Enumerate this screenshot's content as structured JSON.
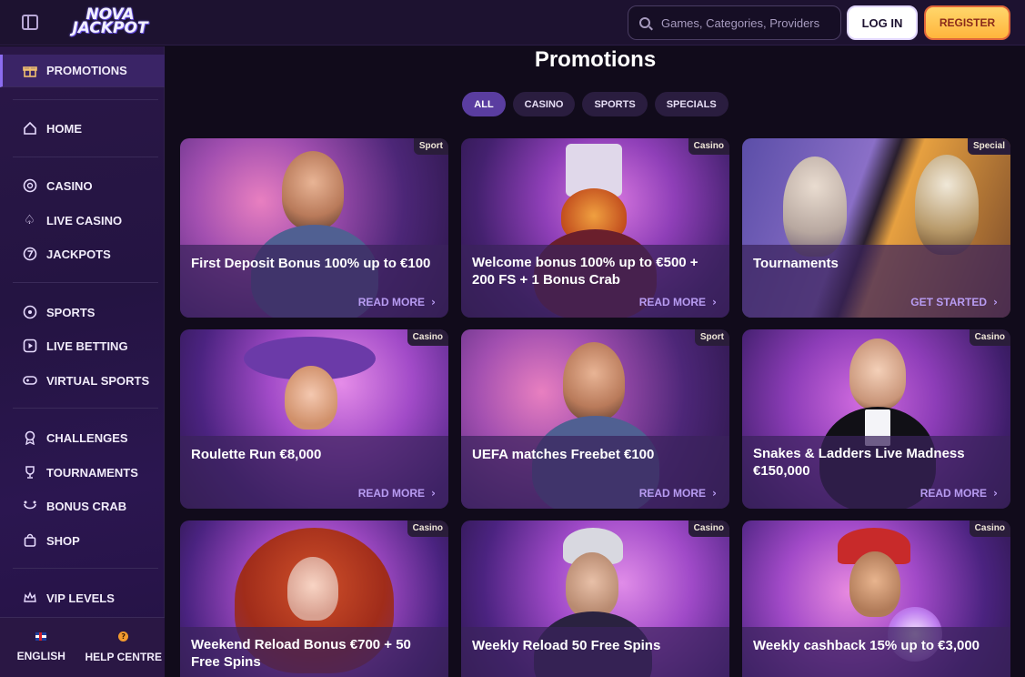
{
  "header": {
    "logo_line1": "NOVA",
    "logo_line2": "JACKPOT",
    "search_placeholder": "Games, Categories, Providers",
    "login_label": "LOG IN",
    "register_label": "REGISTER"
  },
  "sidebar": {
    "items": [
      {
        "label": "PROMOTIONS",
        "icon": "gift-icon"
      },
      {
        "label": "HOME",
        "icon": "home-icon"
      },
      {
        "label": "CASINO",
        "icon": "chip-icon"
      },
      {
        "label": "LIVE CASINO",
        "icon": "spade-icon"
      },
      {
        "label": "JACKPOTS",
        "icon": "seven-icon"
      },
      {
        "label": "SPORTS",
        "icon": "ball-icon"
      },
      {
        "label": "LIVE BETTING",
        "icon": "play-icon"
      },
      {
        "label": "VIRTUAL SPORTS",
        "icon": "gamepad-icon"
      },
      {
        "label": "CHALLENGES",
        "icon": "medal-icon"
      },
      {
        "label": "TOURNAMENTS",
        "icon": "trophy-icon"
      },
      {
        "label": "BONUS CRAB",
        "icon": "crab-icon"
      },
      {
        "label": "SHOP",
        "icon": "bag-icon"
      },
      {
        "label": "VIP LEVELS",
        "icon": "crown-icon"
      }
    ],
    "footer": {
      "language_label": "ENGLISH",
      "help_label": "HELP CENTRE"
    }
  },
  "main": {
    "title": "Promotions",
    "filters": [
      "ALL",
      "CASINO",
      "SPORTS",
      "SPECIALS"
    ],
    "active_filter": "ALL",
    "cards": [
      {
        "tag": "Sport",
        "title": "First Deposit Bonus 100% up to €100",
        "cta": "READ MORE"
      },
      {
        "tag": "Casino",
        "title": "Welcome bonus 100% up to €500 + 200 FS + 1 Bonus Crab",
        "cta": "READ MORE"
      },
      {
        "tag": "Special",
        "title": "Tournaments",
        "cta": "GET STARTED"
      },
      {
        "tag": "Casino",
        "title": "Roulette Run €8,000",
        "cta": "READ MORE"
      },
      {
        "tag": "Sport",
        "title": "UEFA matches Freebet €100",
        "cta": "READ MORE"
      },
      {
        "tag": "Casino",
        "title": "Snakes & Ladders Live Madness €150,000",
        "cta": "READ MORE"
      },
      {
        "tag": "Casino",
        "title": "Weekend Reload Bonus €700 + 50 Free Spins",
        "cta": ""
      },
      {
        "tag": "Casino",
        "title": "Weekly Reload 50 Free Spins",
        "cta": ""
      },
      {
        "tag": "Casino",
        "title": "Weekly cashback 15% up to €3,000",
        "cta": ""
      }
    ]
  },
  "colors": {
    "accent": "#5a3da0",
    "register": "#ffb53c",
    "cta": "#b89cf2"
  }
}
